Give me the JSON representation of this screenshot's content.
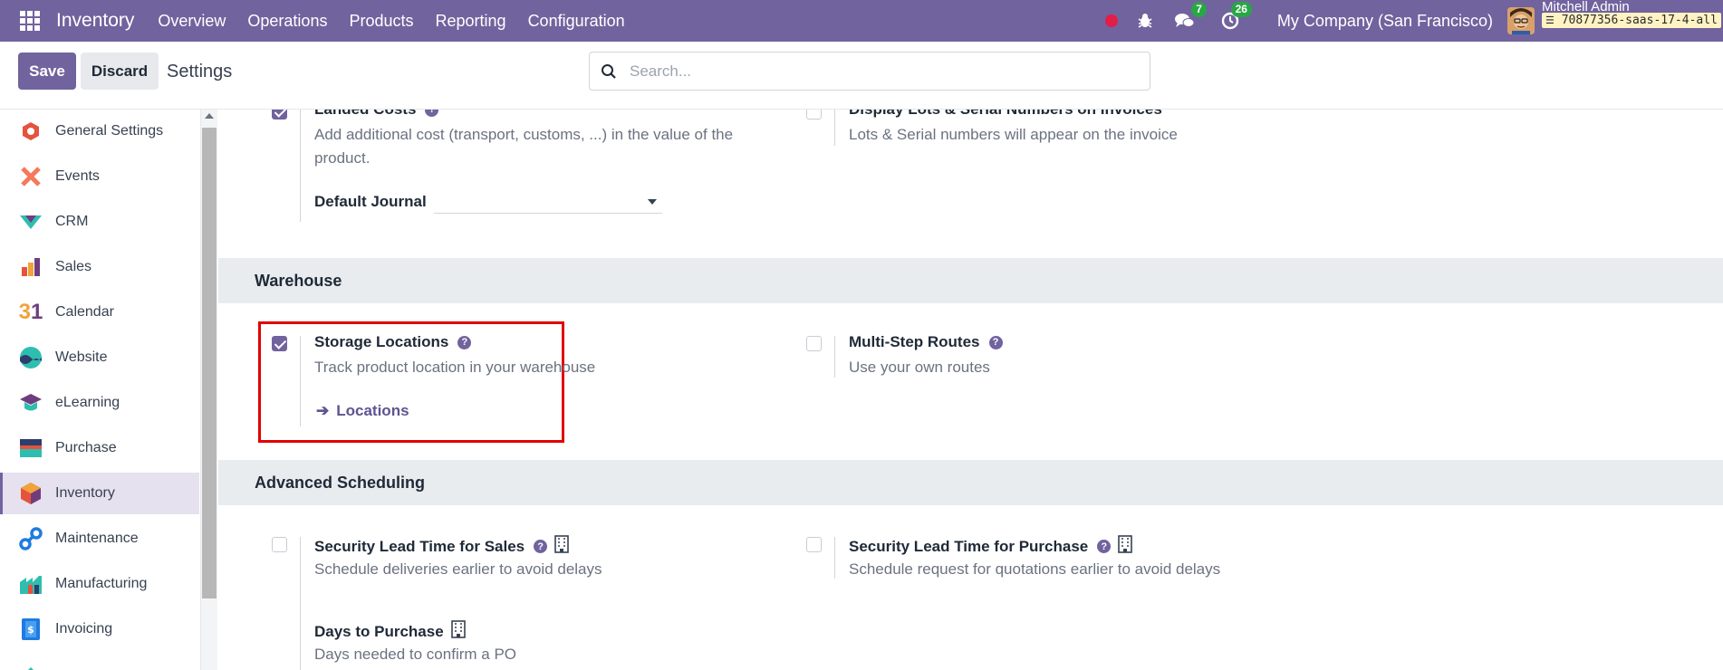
{
  "topbar": {
    "app_name": "Inventory",
    "menu": [
      "Overview",
      "Operations",
      "Products",
      "Reporting",
      "Configuration"
    ],
    "messages_count": "7",
    "activities_count": "26",
    "company": "My Company (San Francisco)",
    "user_name": "Mitchell Admin",
    "database": "70877356-saas-17-4-all"
  },
  "control": {
    "save_label": "Save",
    "discard_label": "Discard",
    "title": "Settings",
    "search_placeholder": "Search..."
  },
  "sidebar": {
    "items": [
      {
        "label": "General Settings",
        "icon": "general-settings-icon",
        "color": "#e5533d"
      },
      {
        "label": "Events",
        "icon": "events-icon",
        "color": "#f5795a"
      },
      {
        "label": "CRM",
        "icon": "crm-icon",
        "color": "#2ebeb0"
      },
      {
        "label": "Sales",
        "icon": "sales-icon",
        "color": "#f0a33b"
      },
      {
        "label": "Calendar",
        "icon": "calendar-icon",
        "color": "#f0a33b"
      },
      {
        "label": "Website",
        "icon": "website-icon",
        "color": "#2ebeb0"
      },
      {
        "label": "eLearning",
        "icon": "elearning-icon",
        "color": "#6f3d7d"
      },
      {
        "label": "Purchase",
        "icon": "purchase-icon",
        "color": "#2c3e6b"
      },
      {
        "label": "Inventory",
        "icon": "inventory-icon",
        "color": "#e5533d"
      },
      {
        "label": "Maintenance",
        "icon": "maintenance-icon",
        "color": "#1f7be0"
      },
      {
        "label": "Manufacturing",
        "icon": "manufacturing-icon",
        "color": "#2ebeb0"
      },
      {
        "label": "Invoicing",
        "icon": "invoicing-icon",
        "color": "#1f7be0"
      }
    ],
    "active_index": 8
  },
  "main": {
    "landed_costs": {
      "title": "Landed Costs",
      "description": "Add additional cost (transport, customs, ...) in the value of the product.",
      "checked": true,
      "field_label": "Default Journal",
      "field_value": ""
    },
    "lots_invoices": {
      "title": "Display Lots & Serial Numbers on Invoices",
      "description": "Lots & Serial numbers will appear on the invoice",
      "checked": false
    },
    "warehouse": {
      "heading": "Warehouse",
      "storage": {
        "title": "Storage Locations",
        "description": "Track product location in your warehouse",
        "checked": true,
        "link_label": "Locations"
      },
      "multistep": {
        "title": "Multi-Step Routes",
        "description": "Use your own routes",
        "checked": false
      }
    },
    "scheduling": {
      "heading": "Advanced Scheduling",
      "lead_sales": {
        "title": "Security Lead Time for Sales",
        "description": "Schedule deliveries earlier to avoid delays",
        "checked": false
      },
      "lead_purchase": {
        "title": "Security Lead Time for Purchase",
        "description": "Schedule request for quotations earlier to avoid delays",
        "checked": false
      },
      "days_purchase": {
        "title": "Days to Purchase",
        "description": "Days needed to confirm a PO"
      }
    }
  }
}
